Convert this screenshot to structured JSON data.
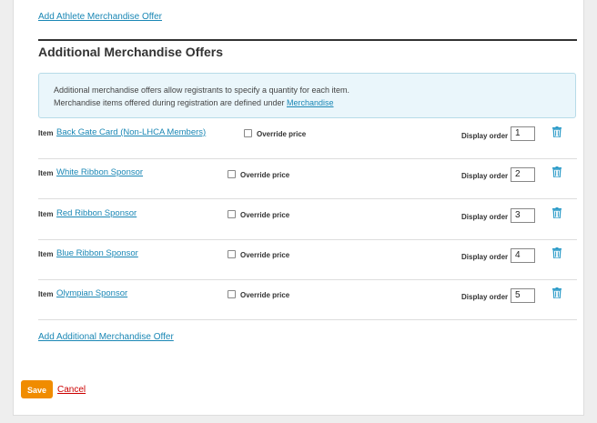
{
  "top_link": "Add Athlete Merchandise Offer",
  "section_title": "Additional Merchandise Offers",
  "info": {
    "line1": "Additional merchandise offers allow registrants to specify a quantity for each item.",
    "line2_prefix": "Merchandise items offered during registration are defined under ",
    "line2_link": "Merchandise"
  },
  "item_label": "Item",
  "override_label": "Override price",
  "display_order_label": "Display order",
  "items": [
    {
      "name": "Back Gate Card (Non-LHCA Members)",
      "order": "1"
    },
    {
      "name": "White Ribbon Sponsor",
      "order": "2"
    },
    {
      "name": "Red Ribbon Sponsor",
      "order": "3"
    },
    {
      "name": "Blue Ribbon Sponsor",
      "order": "4"
    },
    {
      "name": "Olympian Sponsor",
      "order": "5"
    }
  ],
  "add_link": "Add Additional Merchandise Offer",
  "save_label": "Save",
  "cancel_label": "Cancel",
  "colors": {
    "accent": "#1a87b5",
    "save": "#f08c00",
    "cancel": "#cc0000"
  },
  "icons": {
    "delete": "trash-icon",
    "checkbox": "checkbox"
  }
}
